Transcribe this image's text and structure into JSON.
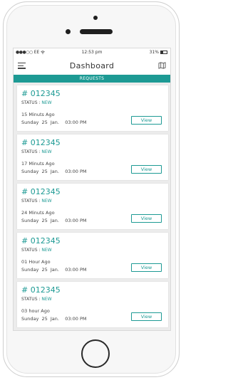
{
  "status_bar": {
    "carrier": "EE",
    "time": "12:53 pm",
    "battery": "31%"
  },
  "nav": {
    "title": "Dashboard",
    "menu_icon": "hamburger-menu-icon",
    "right_icon": "map-icon"
  },
  "section": {
    "label": "REQUESTS"
  },
  "requests": [
    {
      "id": "# 012345",
      "status_label": "STATUS :",
      "status_value": "NEW",
      "ago": "15 Minuts Ago",
      "date": "Sunday  25  Jan.    03:00 PM",
      "view_label": "View"
    },
    {
      "id": "# 012345",
      "status_label": "STATUS :",
      "status_value": "NEW",
      "ago": "17 Minuts Ago",
      "date": "Sunday  25  Jan.    03:00 PM",
      "view_label": "View"
    },
    {
      "id": "# 012345",
      "status_label": "STATUS :",
      "status_value": "NEW",
      "ago": "24 Minuts Ago",
      "date": "Sunday  25  Jan.    03:00 PM",
      "view_label": "View"
    },
    {
      "id": "# 012345",
      "status_label": "STATUS :",
      "status_value": "NEW",
      "ago": "01 Hour Ago",
      "date": "Sunday  25  Jan.    03:00 PM",
      "view_label": "View"
    },
    {
      "id": "# 012345",
      "status_label": "STATUS :",
      "status_value": "NEW",
      "ago": "03 hour Ago",
      "date": "Sunday  25  Jan.    03:00 PM",
      "view_label": "View"
    }
  ],
  "colors": {
    "accent": "#1d9a94",
    "background": "#ececec"
  }
}
